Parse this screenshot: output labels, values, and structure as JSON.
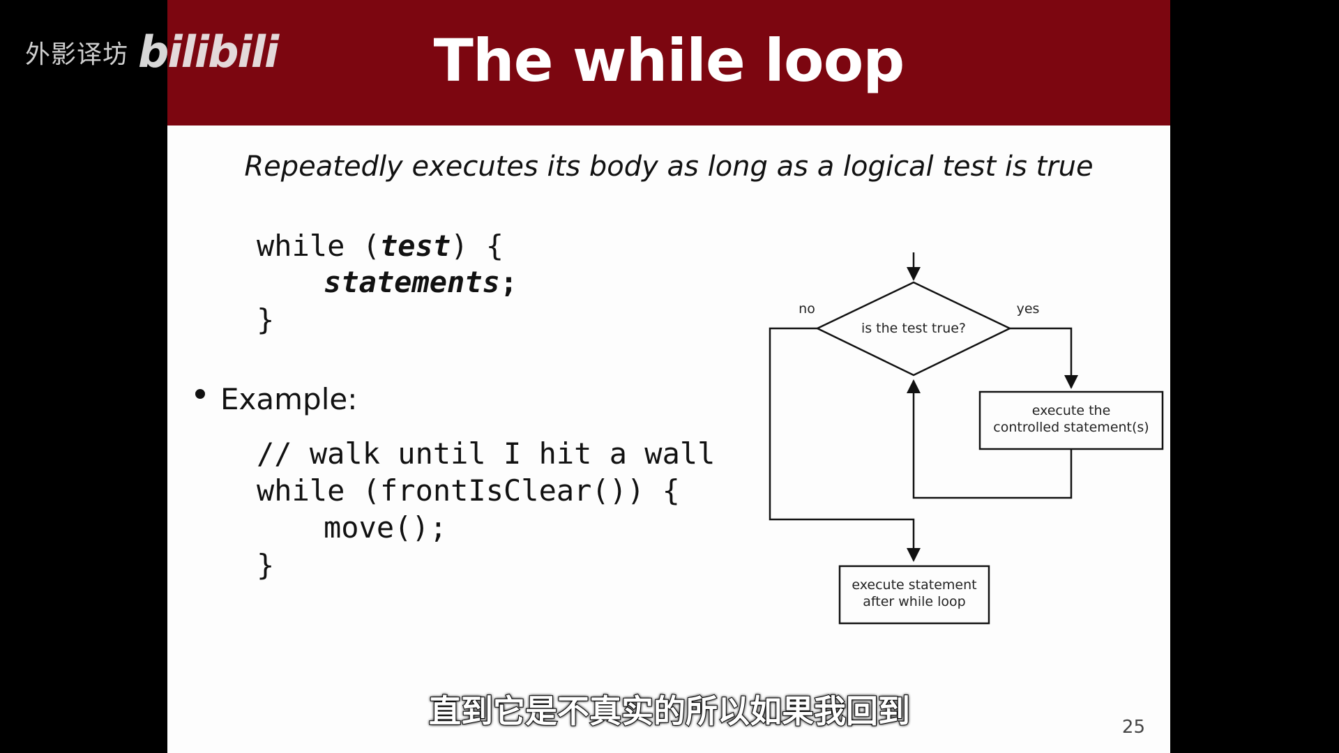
{
  "watermark": {
    "text": "外影译坊",
    "logo": "bilibili"
  },
  "slide": {
    "title": "The while loop",
    "subtitle": "Repeatedly executes its body as long as a logical test is true",
    "syntax": {
      "line1_kw": "while (",
      "line1_test": "test",
      "line1_end": ") {",
      "line2_stmt": "statements",
      "line2_end": ";",
      "line3": "}"
    },
    "bullet_label": "Example:",
    "example": {
      "comment": "// walk until I hit a wall",
      "line1": "while (frontIsClear()) {",
      "line2": "move();",
      "line3": "}"
    },
    "flowchart": {
      "decision": "is the test true?",
      "no_label": "no",
      "yes_label": "yes",
      "body_line1": "execute the",
      "body_line2": "controlled statement(s)",
      "after_line1": "execute statement",
      "after_line2": "after while loop"
    },
    "page_number": "25"
  },
  "caption": "直到它是不真实的所以如果我回到",
  "colors": {
    "title_bar": "#7c0610",
    "slide_bg": "#fdfdfd",
    "outside_bg": "#000000"
  }
}
